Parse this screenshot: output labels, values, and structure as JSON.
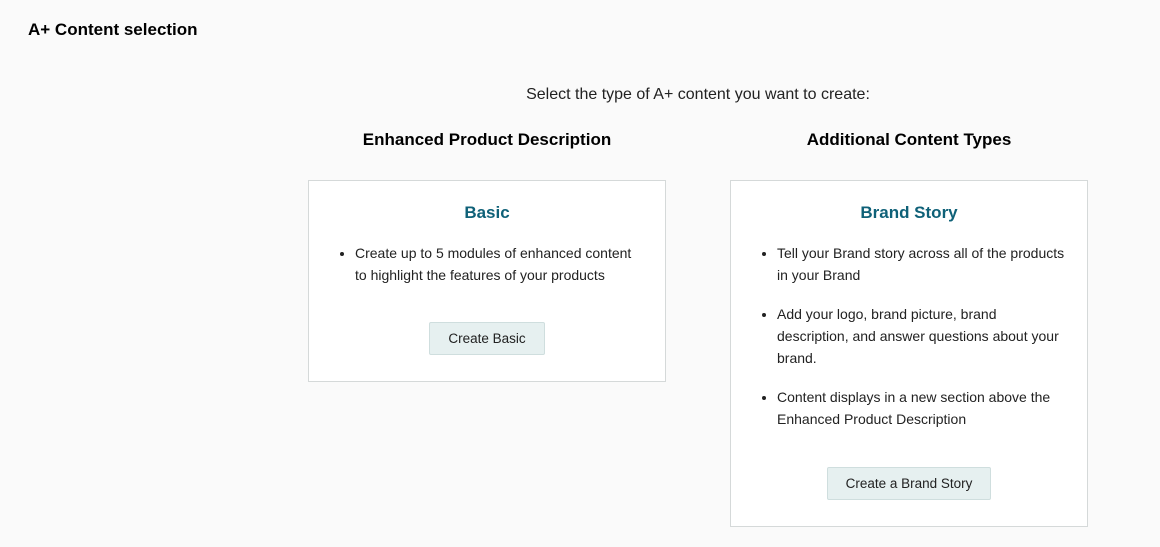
{
  "page": {
    "title": "A+ Content selection",
    "subtitle": "Select the type of A+ content you want to create:"
  },
  "columns": {
    "left": {
      "heading": "Enhanced Product Description",
      "card": {
        "title": "Basic",
        "bullets": [
          "Create up to 5 modules of enhanced content to highlight the features of your products"
        ],
        "button": "Create Basic"
      }
    },
    "right": {
      "heading": "Additional Content Types",
      "card": {
        "title": "Brand Story",
        "bullets": [
          "Tell your Brand story across all of the products in your Brand",
          "Add your logo, brand picture, brand description, and answer questions about your brand.",
          "Content displays in a new section above the Enhanced Product Description"
        ],
        "button": "Create a Brand Story"
      }
    }
  }
}
